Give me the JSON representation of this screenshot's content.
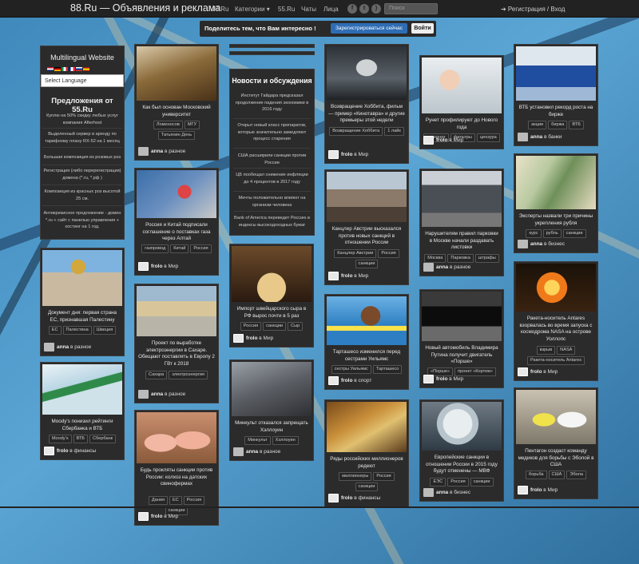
{
  "navbar": {
    "brand": "88.Ru — Объявления и реклама",
    "links": [
      "JJ.Ru",
      "Категории ▾",
      "55.Ru",
      "Чаты",
      "Лица"
    ],
    "social": [
      {
        "icon": "facebook-icon",
        "glyph": "f"
      },
      {
        "icon": "twitter-icon",
        "glyph": "t"
      },
      {
        "icon": "rss-icon",
        "glyph": ")"
      }
    ],
    "search_placeholder": "Поиск",
    "login": "➔ Регистрация / Вход"
  },
  "banner": {
    "text": "Поделитесь тем, что Вам интересно !",
    "register": "Зарегистрироваться сейчас",
    "login": "Войти"
  },
  "sidebar": {
    "title": "Multilingual Website",
    "select_label": "Select Language",
    "offers_title": "Предложения от 55.Ru",
    "offers": [
      "Куплю на 50% скидку любых услуг компания Afterhost",
      "Выделенный сервер в аренду по тарифному плану RX-52 на 1 месяц",
      "Большая композиция из розовых роз",
      "Регистрация (либо перерегистрация) домена (*.ru, *.рф )",
      "Композиция из красных роз высотой 25 см.",
      "Антикризисное предложение - домен *.ru + сайт с панелью управления + хостинг на 1 год."
    ]
  },
  "news": {
    "title": "Новости и обсуждения",
    "items": [
      "Институт Гайдара предсказал продолжение падения экономики в 2016 году",
      "Открыт новый класс препаратов, которые значительно замедляют процесс старения",
      "США расширили санкции против России",
      "ЦБ пообещал снижение инфляции до 4 процентов в 2017 году",
      "Мечты положительно влияют на организм человека",
      "Bank of America переведет Россию в индексы высокодоходных бумаг"
    ]
  },
  "cards": [
    {
      "id": "c1",
      "title": "Как был основан Московский университет",
      "tags": [
        "Ломоносов",
        "МГУ",
        "Татьянин День"
      ],
      "author": "anna",
      "category": "разное"
    },
    {
      "id": "c2",
      "title": "Россия и Китай подписали соглашение о поставках газа через Алтай",
      "tags": [
        "газпровод",
        "Китай",
        "Россия"
      ],
      "author": "frolo",
      "category": "Мир"
    },
    {
      "id": "c3",
      "title": "Проект по выработке электроэнергии в Сахаре. Обещают поставлять в Европу 2 ГВт к 2018",
      "tags": [
        "Сахара",
        "электроэнергия"
      ],
      "author": "anna",
      "category": "разное"
    },
    {
      "id": "c4",
      "title": "Будь прокляты санкции против России: колхоз на датских свинофермах",
      "tags": [
        "Дания",
        "ЕС",
        "Россия",
        "санкции"
      ],
      "author": "frolo",
      "category": "Мир"
    },
    {
      "id": "c5",
      "title": "Документ дня: первая страна ЕС, признавшая Палестину",
      "tags": [
        "ЕС",
        "Палестина",
        "Швеция"
      ],
      "author": "anna",
      "category": "разное"
    },
    {
      "id": "c6",
      "title": "Moody's понизил рейтинги Сбербанка и ВТБ",
      "tags": [
        "Moody's",
        "ВТБ",
        "Сбербанк"
      ],
      "author": "frolo",
      "category": "финансы"
    },
    {
      "id": "c7",
      "title": "Импорт швейцарского сыра в РФ вырос почти в 5 раз",
      "tags": [
        "Россия",
        "санкции",
        "Сыр"
      ],
      "author": "frolo",
      "category": "Мир"
    },
    {
      "id": "c8",
      "title": "Минкульт отказался запрещать Хэллоуин",
      "tags": [
        "Минкульт",
        "Хэллоуин"
      ],
      "author": "anna",
      "category": "разное"
    },
    {
      "id": "c9",
      "title": "Возвращение Хоббита, фильм — пример «Кинотавра» и другие премьеры этой недели",
      "tags": [
        "Возвращение Хоббита",
        "1 лайк"
      ],
      "author": "frolo",
      "category": "Мир"
    },
    {
      "id": "c10",
      "title": "Канцлер Австрии высказался против новых санкций в отношении России",
      "tags": [
        "Канцлер Австрии",
        "Россия",
        "санкции"
      ],
      "author": "frolo",
      "category": "Мир"
    },
    {
      "id": "c11",
      "title": "Тарташесо изменился перед сестрами Уильямс",
      "tags": [
        "сестры Уильямс",
        "Тарташесо"
      ],
      "author": "frolo",
      "category": "спорт"
    },
    {
      "id": "c12",
      "title": "Ряды российских миллионеров редеют",
      "tags": [
        "миллионеры",
        "Россия",
        "санкции"
      ],
      "author": "frolo",
      "category": "финансы"
    },
    {
      "id": "c13",
      "title": "Рунет профилируют до Нового года",
      "tags": [
        "интернет",
        "фильтры",
        "цензура"
      ],
      "author": "frolo",
      "category": "Мир"
    },
    {
      "id": "c14",
      "title": "Нарушителям правил парковки в Москве начали раздавать листовки",
      "tags": [
        "Москва",
        "Парковка",
        "штрафы"
      ],
      "author": "anna",
      "category": "разное"
    },
    {
      "id": "c15",
      "title": "Новый автомобиль Владимира Путина получит двигатель «Порше»",
      "tags": [
        "«Порше»",
        "проект «Кортеж»"
      ],
      "author": "frolo",
      "category": "Мир"
    },
    {
      "id": "c16",
      "title": "Европейские санкции в отношении России в 2015 году будут отменены — МВФ",
      "tags": [
        "ЕЭС",
        "Россия",
        "санкции"
      ],
      "author": "anna",
      "category": "бизнес"
    },
    {
      "id": "c17",
      "title": "ВТБ установил рекорд роста на бирже",
      "tags": [
        "акции",
        "биржа",
        "ВТБ"
      ],
      "author": "anna",
      "category": "банки"
    },
    {
      "id": "c18",
      "title": "Эксперты назвали три причины укрепления рубля",
      "tags": [
        "курс",
        "рубль",
        "санкции"
      ],
      "author": "anna",
      "category": "бизнес"
    },
    {
      "id": "c19",
      "title": "Ракета-носитель Antares взорвалась во время запуска с космодрома NASA на острове Уоллопс",
      "tags": [
        "взрыв",
        "NASA",
        "Ракета-носитель Antares"
      ],
      "author": "frolo",
      "category": "Мир"
    },
    {
      "id": "c20",
      "title": "Пентагон создаст команду медиков для борьбы с Эболой в США",
      "tags": [
        "борьба",
        "США",
        "Эбола"
      ],
      "author": "frolo",
      "category": "Мир"
    }
  ],
  "byline_in": "в",
  "colors": {
    "navbar": "#222222",
    "card": "#2b2b2b",
    "accent": "#2e6db4",
    "background": "#4f9ac7"
  }
}
